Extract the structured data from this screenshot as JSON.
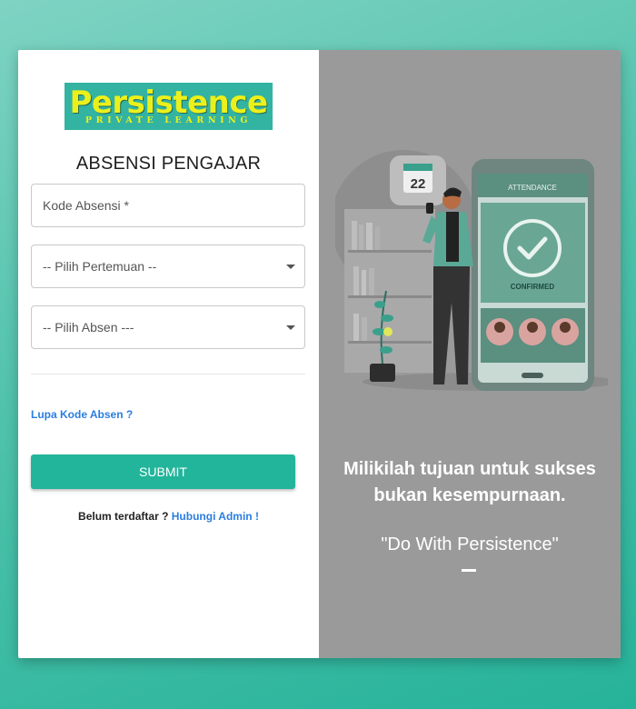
{
  "brand": {
    "logo_main": "Persistence",
    "logo_sub": "PRIVATE LEARNING",
    "colors": {
      "logo_bg": "#33b3a2",
      "logo_text": "#ecf01a",
      "accent": "#22b59b",
      "link": "#2a7de0"
    }
  },
  "form": {
    "title": "ABSENSI PENGAJAR",
    "kode_placeholder": "Kode Absensi *",
    "pertemuan_selected": "-- Pilih Pertemuan --",
    "absen_selected": "-- Pilih Absen ---",
    "forgot_link": "Lupa Kode Absen ?",
    "submit_label": "SUBMIT",
    "register_text": "Belum terdaftar ?",
    "register_link": "Hubungi Admin !"
  },
  "illustration": {
    "calendar_day": "22",
    "phone_header": "ATTENDANCE",
    "phone_status": "CONFIRMED",
    "icons": [
      "calendar-icon",
      "check-circle-icon",
      "avatar-icon",
      "plant-icon",
      "bookshelf-icon"
    ]
  },
  "aside": {
    "tagline_line1": "Milikilah tujuan untuk sukses",
    "tagline_line2": "bukan kesempurnaan.",
    "quote": "\"Do With Persistence\""
  }
}
